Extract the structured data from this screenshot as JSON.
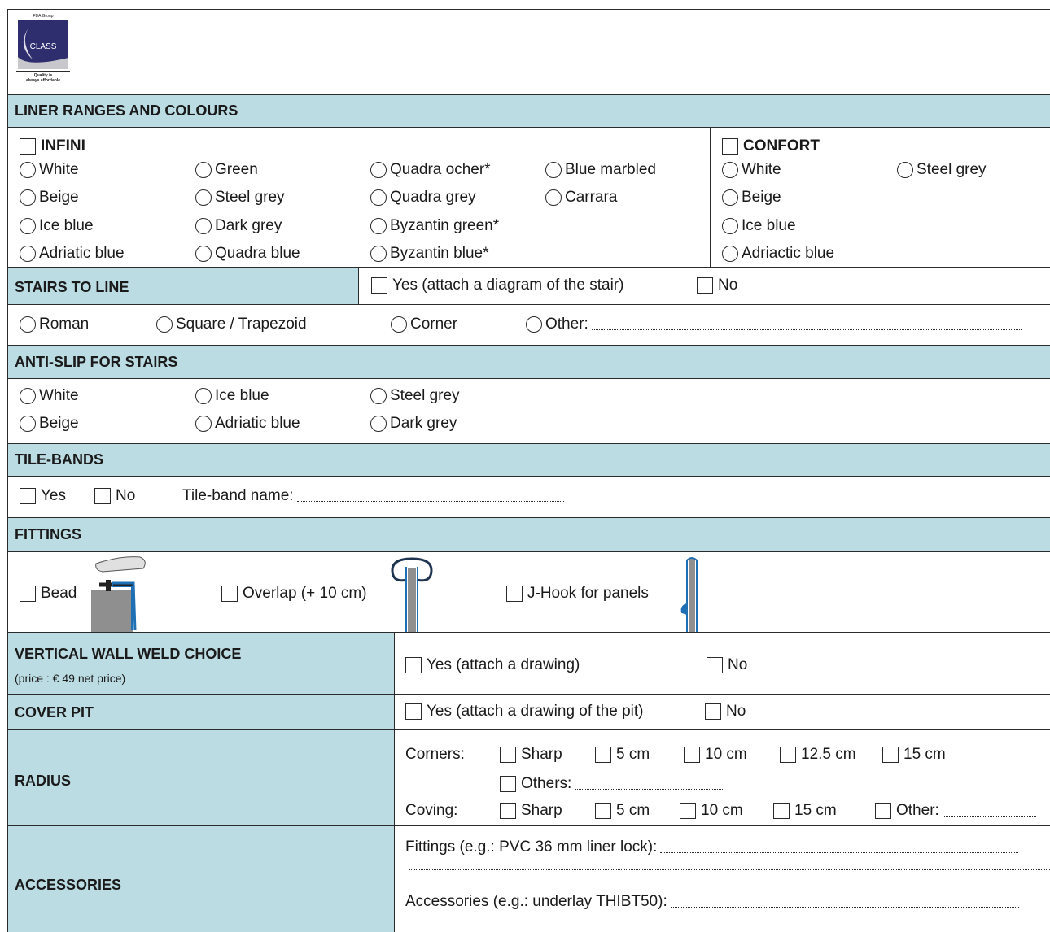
{
  "logo": {
    "group": "FDA Group",
    "brand": "CLASS",
    "tagline_1": "Quality is",
    "tagline_2": "always affordable"
  },
  "liner": {
    "header": "LINER RANGES AND COLOURS",
    "infini": {
      "label": "INFINI",
      "options": [
        "White",
        "Green",
        "Quadra ocher*",
        "Blue marbled",
        "Beige",
        "Steel grey",
        "Quadra grey",
        "Carrara",
        "Ice blue",
        "Dark grey",
        "Byzantin green*",
        "Adriatic blue",
        "Quadra blue",
        "Byzantin blue*"
      ]
    },
    "confort": {
      "label": "CONFORT",
      "options": [
        "White",
        "Steel grey",
        "Beige",
        "Ice blue",
        "Adriactic blue"
      ]
    }
  },
  "stairs": {
    "header": "STAIRS TO LINE",
    "yes": "Yes (attach a diagram of the stair)",
    "no": "No",
    "types": [
      "Roman",
      "Square / Trapezoid",
      "Corner",
      "Other:"
    ]
  },
  "antislip": {
    "header": "ANTI-SLIP FOR STAIRS",
    "options": [
      "White",
      "Ice blue",
      "Steel grey",
      "Beige",
      "Adriatic blue",
      "Dark grey"
    ]
  },
  "tilebands": {
    "header": "TILE-BANDS",
    "yes": "Yes",
    "no": "No",
    "name_label": "Tile-band name:"
  },
  "fittings": {
    "header": "FITTINGS",
    "bead": "Bead",
    "overlap": "Overlap (+ 10 cm)",
    "jhook": "J-Hook for panels"
  },
  "weld": {
    "label": "VERTICAL WALL WELD CHOICE",
    "price": "(price : € 49 net price)",
    "yes": "Yes (attach a drawing)",
    "no": "No"
  },
  "coverpit": {
    "label": "COVER PIT",
    "yes": "Yes (attach a drawing of the pit)",
    "no": "No"
  },
  "radius": {
    "label": "RADIUS",
    "corners_label": "Corners:",
    "corners": [
      "Sharp",
      "5 cm",
      "10 cm",
      "12.5 cm",
      "15 cm"
    ],
    "others": "Others:",
    "coving_label": "Coving:",
    "coving": [
      "Sharp",
      "5 cm",
      "10 cm",
      "15 cm",
      "Other:"
    ]
  },
  "accessories": {
    "label": "ACCESSORIES",
    "fittings_line": "Fittings (e.g.: PVC 36 mm liner lock):",
    "accessories_line": "Accessories (e.g.: underlay THIBT50):"
  },
  "colors": {
    "header_bg": "#bcdce4",
    "brand_navy": "#2e2d6e",
    "brand_grey": "#c8c8cc",
    "fitting_blue": "#1f6fb5"
  }
}
